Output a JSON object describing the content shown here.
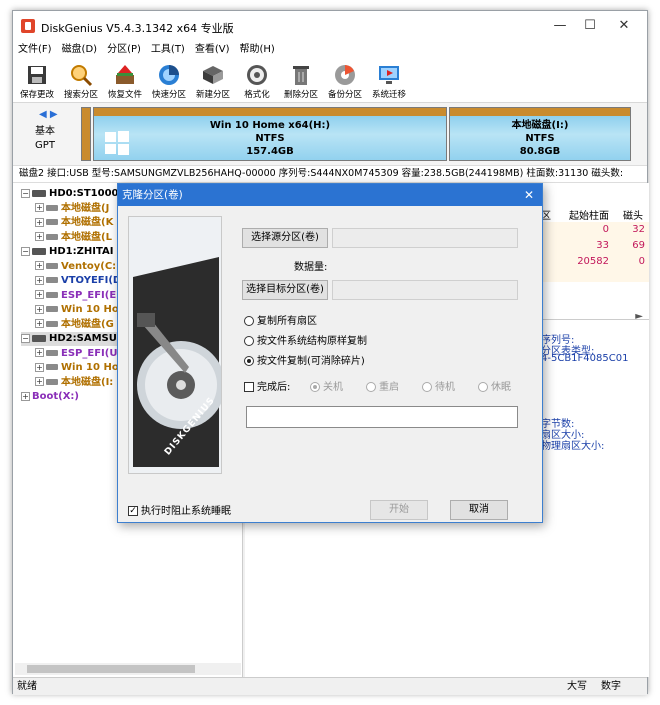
{
  "window": {
    "title": "DiskGenius V5.4.3.1342 x64 专业版",
    "minimize": "—",
    "maximize": "☐",
    "close": "✕"
  },
  "menu": [
    "文件(F)",
    "磁盘(D)",
    "分区(P)",
    "工具(T)",
    "查看(V)",
    "帮助(H)"
  ],
  "toolbar": [
    {
      "label": "保存更改",
      "icon": "save-icon"
    },
    {
      "label": "搜索分区",
      "icon": "magnifier-icon"
    },
    {
      "label": "恢复文件",
      "icon": "recover-icon"
    },
    {
      "label": "快速分区",
      "icon": "quick-partition-icon"
    },
    {
      "label": "新建分区",
      "icon": "new-partition-icon"
    },
    {
      "label": "格式化",
      "icon": "format-icon"
    },
    {
      "label": "删除分区",
      "icon": "trash-icon"
    },
    {
      "label": "备份分区",
      "icon": "backup-icon"
    },
    {
      "label": "系统迁移",
      "icon": "migrate-icon"
    }
  ],
  "diskmap": {
    "arrows": "◀ ▶",
    "basic": "基本",
    "gpt": "GPT",
    "partitions": [
      {
        "name": "Win 10 Home x64(H:)",
        "fs": "NTFS",
        "size": "157.4GB"
      },
      {
        "name": "本地磁盘(I:)",
        "fs": "NTFS",
        "size": "80.8GB"
      }
    ]
  },
  "disk_info": "磁盘2 接口:USB  型号:SAMSUNGMZVLB256HAHQ-00000  序列号:S444NX0M745309  容量:238.5GB(244198MB)  柱面数:31130  磁头数:",
  "tree": [
    {
      "text": "HD0:ST1000",
      "type": "disk",
      "color": "#000000"
    },
    {
      "text": "本地磁盘(J",
      "type": "part",
      "color": "#b07000"
    },
    {
      "text": "本地磁盘(K",
      "type": "part",
      "color": "#b07000"
    },
    {
      "text": "本地磁盘(L",
      "type": "part",
      "color": "#b07000"
    },
    {
      "text": "HD1:ZHITAI",
      "type": "disk",
      "color": "#000000"
    },
    {
      "text": "Ventoy(C:",
      "type": "part",
      "color": "#b07000"
    },
    {
      "text": "VTOYEFI(D",
      "type": "part",
      "color": "#1a3fa8"
    },
    {
      "text": "ESP_EFI(E:",
      "type": "part",
      "color": "#8a2fb8"
    },
    {
      "text": "Win 10 Ho",
      "type": "part",
      "color": "#b07000"
    },
    {
      "text": "本地磁盘(G",
      "type": "part",
      "color": "#b07000"
    },
    {
      "text": "HD2:SAMSUN",
      "type": "disk",
      "color": "#000000"
    },
    {
      "text": "ESP_EFI(U",
      "type": "part",
      "color": "#8a2fb8"
    },
    {
      "text": "Win 10 Ho",
      "type": "part",
      "color": "#b07000"
    },
    {
      "text": "本地磁盘(I:",
      "type": "part",
      "color": "#b07000"
    },
    {
      "text": "Boot(X:)",
      "type": "boot",
      "color": "#8a2fb8"
    }
  ],
  "right_panel": {
    "headers": [
      "区",
      "起始柱面",
      "磁头"
    ],
    "rows": [
      [
        "0",
        "32"
      ],
      [
        "33",
        "69"
      ],
      [
        "20582",
        "0"
      ]
    ],
    "info1": [
      "序列号:",
      "分区表类型:",
      "4-5CB1F4085C01"
    ],
    "info2": [
      "字节数:",
      "扇区大小:",
      "物理扇区大小:"
    ]
  },
  "dialog": {
    "title": "克隆分区(卷)",
    "close": "✕",
    "brand": "DISKGENIUS",
    "select_source": "选择源分区(卷)",
    "data_amount": "数据量:",
    "select_target": "选择目标分区(卷)",
    "radios": [
      "复制所有扇区",
      "按文件系统结构原样复制",
      "按文件复制(可消除碎片)"
    ],
    "after_label": "完成后:",
    "after_options": [
      "关机",
      "重启",
      "待机",
      "休眠"
    ],
    "prevent_sleep": "执行时阻止系统睡眠",
    "start": "开始",
    "cancel": "取消"
  },
  "status": {
    "ready": "就绪",
    "caps": "大写",
    "num": "数字"
  }
}
